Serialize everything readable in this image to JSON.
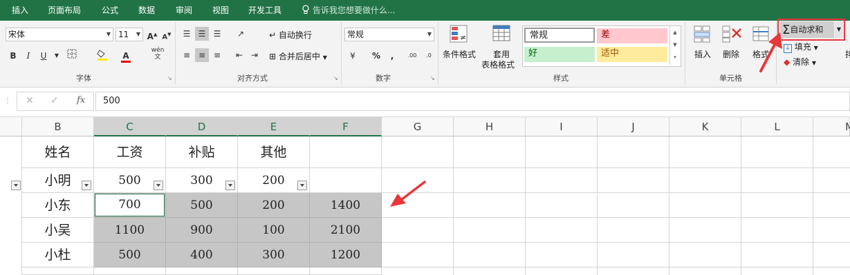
{
  "tabs": [
    "插入",
    "页面布局",
    "公式",
    "数据",
    "审阅",
    "视图",
    "开发工具"
  ],
  "tell_me": "告诉我您想要做什么...",
  "font": {
    "name": "宋体",
    "size": "11",
    "group_label": "字体",
    "bold": "B",
    "italic": "I",
    "underline": "U",
    "phonetic": "wén"
  },
  "alignment": {
    "wrap": "自动换行",
    "merge": "合并后居中",
    "group_label": "对齐方式"
  },
  "number": {
    "format": "常规",
    "group_label": "数字",
    "percent": "%",
    "comma": ","
  },
  "styles": {
    "conditional": "条件格式",
    "table_line1": "套用",
    "table_line2": "表格格式",
    "normal": "常规",
    "bad": "差",
    "good": "好",
    "neutral": "适中",
    "group_label": "样式"
  },
  "cells_group": {
    "insert": "插入",
    "delete": "删除",
    "format": "格式",
    "group_label": "单元格"
  },
  "editing": {
    "autosum": "自动求和",
    "fill": "填充",
    "clear": "清除"
  },
  "formula_bar": {
    "value": "500",
    "fx": "fx"
  },
  "columns": [
    "B",
    "C",
    "D",
    "E",
    "F",
    "G",
    "H",
    "I",
    "J",
    "K",
    "L",
    "M"
  ],
  "table": {
    "headers": [
      "姓名",
      "工资",
      "补贴",
      "其他"
    ],
    "rows": [
      [
        "小明",
        "500",
        "300",
        "200",
        ""
      ],
      [
        "小东",
        "700",
        "500",
        "200",
        "1400"
      ],
      [
        "小吴",
        "1100",
        "900",
        "100",
        "2100"
      ],
      [
        "小杜",
        "500",
        "400",
        "300",
        "1200"
      ]
    ]
  },
  "colors": {
    "excel_green": "#217346",
    "selection_gray": "#c6c6c6",
    "annotation_red": "#e8363b",
    "bad_fill": "#ffc7ce",
    "good_fill": "#c6efce",
    "neutral_fill": "#ffeb9c"
  }
}
